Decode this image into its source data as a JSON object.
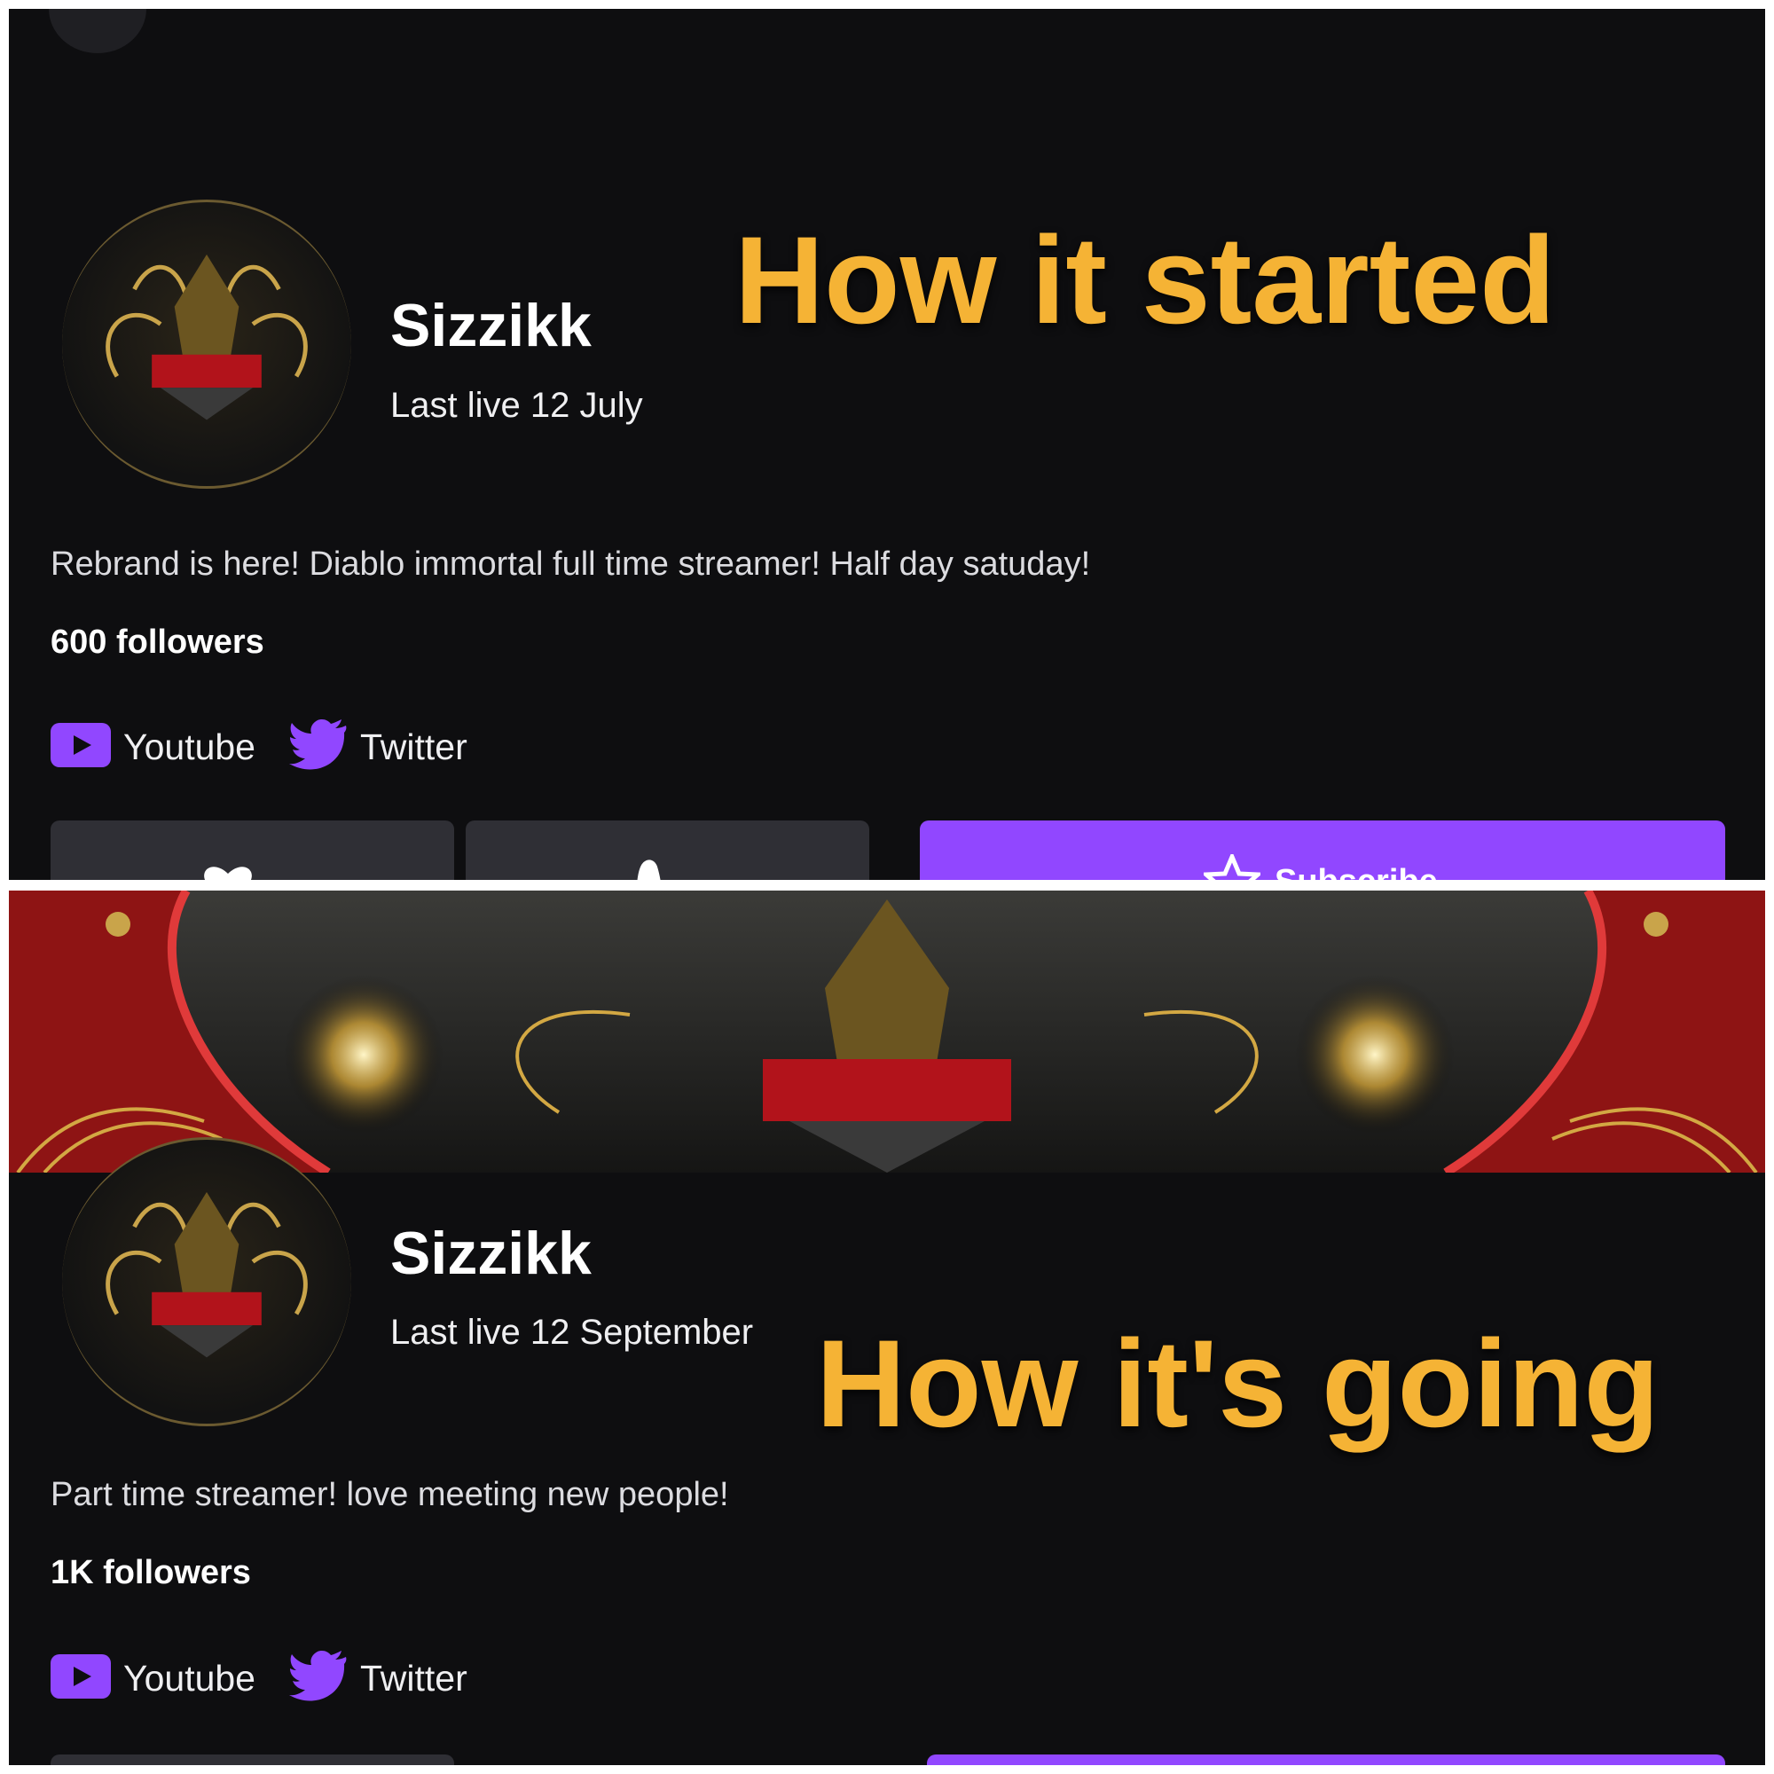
{
  "top": {
    "caption": "How it started",
    "username": "Sizzikk",
    "last_live": "Last live 12 July",
    "bio": "Rebrand is here! Diablo immortal full time streamer! Half day satuday!",
    "followers": "600 followers",
    "socials": [
      {
        "label": "Youtube",
        "icon": "youtube-icon"
      },
      {
        "label": "Twitter",
        "icon": "twitter-icon"
      }
    ],
    "subscribe_label": "Subscribe"
  },
  "bottom": {
    "caption": "How it's going",
    "username": "Sizzikk",
    "last_live": "Last live 12 September",
    "bio": "Part time streamer! love meeting new people!",
    "followers": "1K followers",
    "socials": [
      {
        "label": "Youtube",
        "icon": "youtube-icon"
      },
      {
        "label": "Twitter",
        "icon": "twitter-icon"
      }
    ]
  },
  "colors": {
    "background": "#0e0e10",
    "caption": "#f5b335",
    "accent_purple": "#9147ff",
    "button_dark": "#2f2f35",
    "banner_red": "#8e1414"
  }
}
